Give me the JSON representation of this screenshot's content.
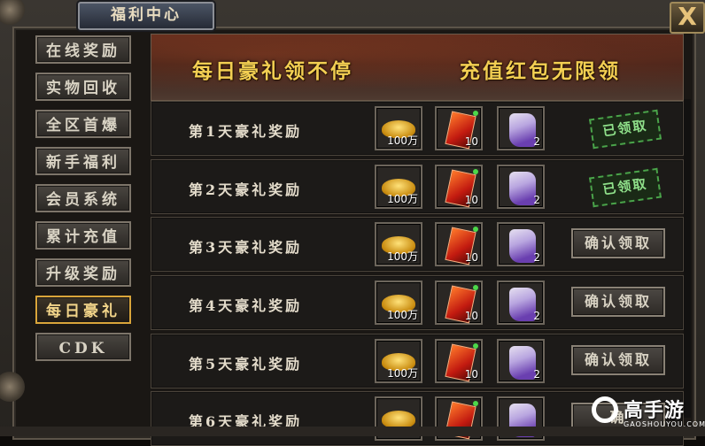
{
  "window": {
    "title": "福利中心",
    "close_label": "X"
  },
  "sidebar": {
    "items": [
      {
        "label": "在线奖励",
        "active": false
      },
      {
        "label": "实物回收",
        "active": false
      },
      {
        "label": "全区首爆",
        "active": false
      },
      {
        "label": "新手福利",
        "active": false
      },
      {
        "label": "会员系统",
        "active": false
      },
      {
        "label": "累计充值",
        "active": false
      },
      {
        "label": "升级奖励",
        "active": false
      },
      {
        "label": "每日豪礼",
        "active": true
      },
      {
        "label": "CDK",
        "active": false
      }
    ]
  },
  "banner": {
    "left_text": "每日豪礼领不停",
    "right_text": "充值红包无限领"
  },
  "rewards": {
    "rows": [
      {
        "label": "第1天豪礼奖励",
        "items": [
          {
            "icon": "gold-ingot-icon",
            "count": "100万"
          },
          {
            "icon": "red-book-icon",
            "count": "10"
          },
          {
            "icon": "purple-scroll-icon",
            "count": "2"
          }
        ],
        "status": "claimed",
        "status_label": "已领取"
      },
      {
        "label": "第2天豪礼奖励",
        "items": [
          {
            "icon": "gold-ingot-icon",
            "count": "100万"
          },
          {
            "icon": "red-book-icon",
            "count": "10"
          },
          {
            "icon": "purple-scroll-icon",
            "count": "2"
          }
        ],
        "status": "claimed",
        "status_label": "已领取"
      },
      {
        "label": "第3天豪礼奖励",
        "items": [
          {
            "icon": "gold-ingot-icon",
            "count": "100万"
          },
          {
            "icon": "red-book-icon",
            "count": "10"
          },
          {
            "icon": "purple-scroll-icon",
            "count": "2"
          }
        ],
        "status": "claim",
        "status_label": "确认领取"
      },
      {
        "label": "第4天豪礼奖励",
        "items": [
          {
            "icon": "gold-ingot-icon",
            "count": "100万"
          },
          {
            "icon": "red-book-icon",
            "count": "10"
          },
          {
            "icon": "purple-scroll-icon",
            "count": "2"
          }
        ],
        "status": "claim",
        "status_label": "确认领取"
      },
      {
        "label": "第5天豪礼奖励",
        "items": [
          {
            "icon": "gold-ingot-icon",
            "count": "100万"
          },
          {
            "icon": "red-book-icon",
            "count": "10"
          },
          {
            "icon": "purple-scroll-icon",
            "count": "2"
          }
        ],
        "status": "claim",
        "status_label": "确认领取"
      },
      {
        "label": "第6天豪礼奖励",
        "items": [
          {
            "icon": "gold-ingot-icon",
            "count": ""
          },
          {
            "icon": "red-book-icon",
            "count": ""
          },
          {
            "icon": "purple-scroll-icon",
            "count": ""
          }
        ],
        "status": "claim",
        "status_label": "确"
      }
    ]
  },
  "watermark": {
    "text": "高手游",
    "sub": "GAOSHOUYOU.COM"
  },
  "colors": {
    "banner_text": "#f3cf52",
    "active_border": "#d9a53a",
    "claimed_green": "#8fe08a"
  }
}
